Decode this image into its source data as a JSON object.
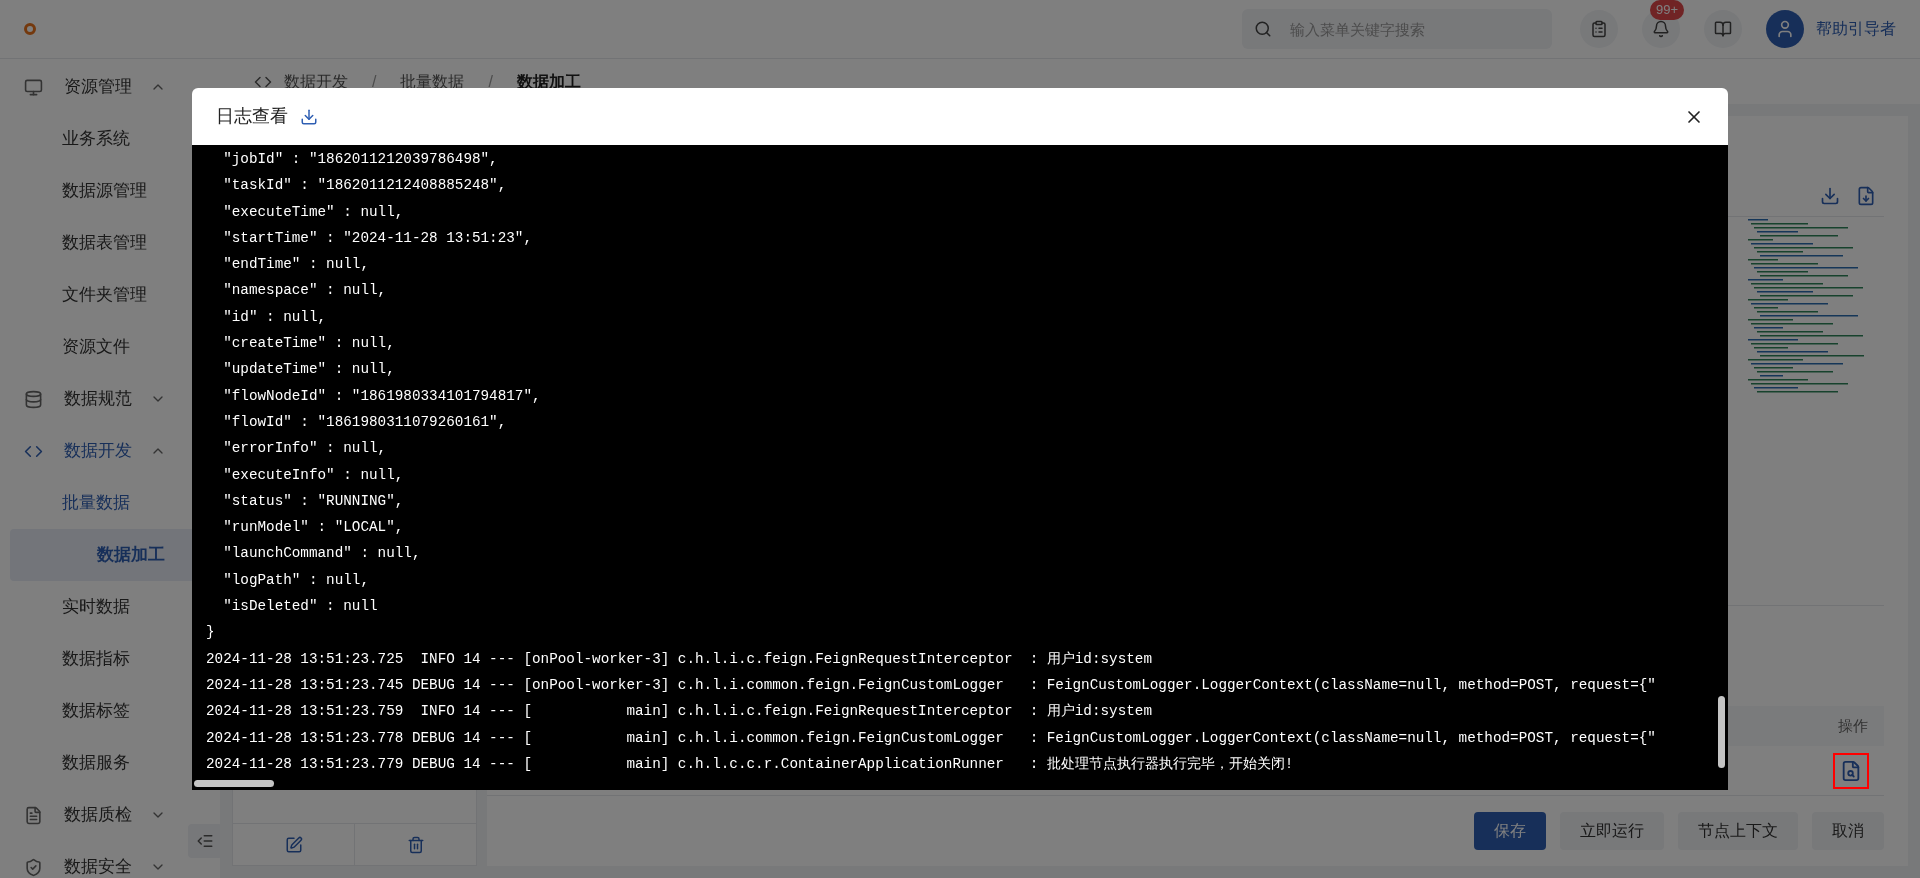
{
  "topbar": {
    "search": {
      "placeholder": "输入菜单关键字搜索"
    },
    "notification_badge": "99+",
    "user": "帮助引导者"
  },
  "sidebar": {
    "items": [
      {
        "label": "资源管理",
        "expanded": true,
        "children": [
          {
            "label": "业务系统",
            "selected": false
          },
          {
            "label": "数据源管理",
            "selected": false
          },
          {
            "label": "数据表管理",
            "selected": false
          },
          {
            "label": "文件夹管理",
            "selected": false
          },
          {
            "label": "资源文件",
            "selected": false
          }
        ]
      },
      {
        "label": "数据规范",
        "expanded": false
      },
      {
        "label": "数据开发",
        "expanded": true,
        "children": [
          {
            "label": "批量数据",
            "expanded": true,
            "children": [
              {
                "label": "数据加工",
                "selected": true
              }
            ]
          },
          {
            "label": "实时数据",
            "selected": false
          },
          {
            "label": "数据指标",
            "selected": false
          },
          {
            "label": "数据标签",
            "selected": false
          },
          {
            "label": "数据服务",
            "selected": false
          }
        ]
      },
      {
        "label": "数据质检",
        "expanded": false
      },
      {
        "label": "数据安全",
        "expanded": false
      }
    ]
  },
  "breadcrumb": [
    "数据开发",
    "批量数据",
    "数据加工"
  ],
  "breadcrumb_separator": "/",
  "table": {
    "columns": [
      "操作"
    ]
  },
  "buttons": [
    {
      "label": "保存",
      "kind": "primary"
    },
    {
      "label": "立即运行",
      "kind": "default"
    },
    {
      "label": "节点上下文",
      "kind": "default"
    },
    {
      "label": "取消",
      "kind": "default"
    }
  ],
  "modal": {
    "title": "日志查看",
    "log_lines": [
      "  \"jobId\" : \"1862011212039786498\",",
      "  \"taskId\" : \"1862011212408885248\",",
      "  \"executeTime\" : null,",
      "  \"startTime\" : \"2024-11-28 13:51:23\",",
      "  \"endTime\" : null,",
      "  \"namespace\" : null,",
      "  \"id\" : null,",
      "  \"createTime\" : null,",
      "  \"updateTime\" : null,",
      "  \"flowNodeId\" : \"1861980334101794817\",",
      "  \"flowId\" : \"1861980311079260161\",",
      "  \"errorInfo\" : null,",
      "  \"executeInfo\" : null,",
      "  \"status\" : \"RUNNING\",",
      "  \"runModel\" : \"LOCAL\",",
      "  \"launchCommand\" : null,",
      "  \"logPath\" : null,",
      "  \"isDeleted\" : null",
      "}",
      "2024-11-28 13:51:23.725  INFO 14 --- [onPool-worker-3] c.h.l.i.c.feign.FeignRequestInterceptor  : 用户id:system",
      "2024-11-28 13:51:23.745 DEBUG 14 --- [onPool-worker-3] c.h.l.i.common.feign.FeignCustomLogger   : FeignCustomLogger.LoggerContext(className=null, method=POST, request={\"",
      "2024-11-28 13:51:23.759  INFO 14 --- [           main] c.h.l.i.c.feign.FeignRequestInterceptor  : 用户id:system",
      "2024-11-28 13:51:23.778 DEBUG 14 --- [           main] c.h.l.i.common.feign.FeignCustomLogger   : FeignCustomLogger.LoggerContext(className=null, method=POST, request={\"",
      "2024-11-28 13:51:23.779 DEBUG 14 --- [           main] c.h.l.c.c.r.ContainerApplicationRunner   : 批处理节点执行器执行完毕，开始关闭!"
    ]
  }
}
